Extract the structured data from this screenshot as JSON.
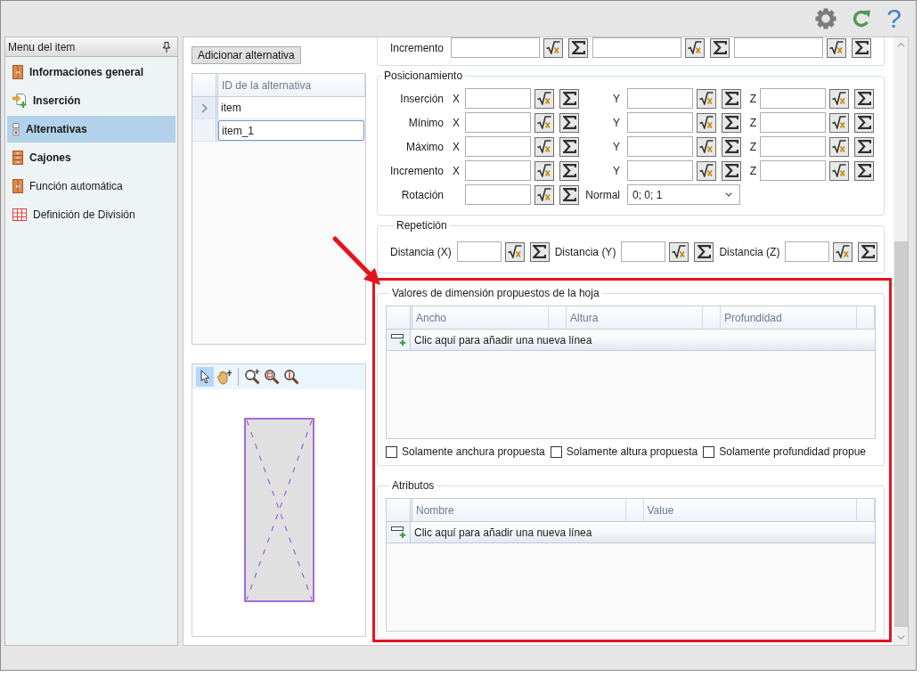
{
  "header": {
    "help_button": "?"
  },
  "sidebar": {
    "title": "Menu del item",
    "items": [
      {
        "label": "Informaciones general",
        "kind": "cabinet",
        "bold": true,
        "selected": false
      },
      {
        "label": "Inserción",
        "kind": "insert",
        "bold": true,
        "selected": false
      },
      {
        "label": "Alternativas",
        "kind": "alternatives",
        "bold": true,
        "selected": true
      },
      {
        "label": "Cajones",
        "kind": "drawers",
        "bold": true,
        "selected": false
      },
      {
        "label": "Función automática",
        "kind": "cabinet",
        "bold": false,
        "selected": false
      },
      {
        "label": "Definición de División",
        "kind": "grid",
        "bold": false,
        "selected": false
      }
    ]
  },
  "alternatives": {
    "add_button": "Adicionar alternativa",
    "column": "ID de la alternativa",
    "rows": [
      {
        "id": "item",
        "selected": true,
        "editing": false
      },
      {
        "id": "item_1",
        "selected": false,
        "editing": true
      }
    ]
  },
  "preview": {
    "tool_groups": [
      [
        {
          "kind": "pointer",
          "selected": true
        },
        {
          "kind": "pan",
          "selected": false
        }
      ],
      [
        {
          "kind": "zoom-in",
          "selected": false
        },
        {
          "kind": "zoom-window",
          "selected": false
        },
        {
          "kind": "zoom-extents",
          "selected": false
        }
      ]
    ]
  },
  "form": {
    "sections": [
      {
        "kind": "fields",
        "rows": [
          {
            "label": "Incremento",
            "fields": [
              {
                "kind": "number"
              },
              {
                "kind": "number"
              },
              {
                "kind": "number"
              }
            ]
          }
        ]
      },
      {
        "kind": "fields",
        "title": "Posicionamiento",
        "rows": [
          {
            "label": "Inserción",
            "fields": [
              {
                "kind": "number",
                "axis": "X"
              },
              {
                "kind": "number",
                "axis": "Y"
              },
              {
                "kind": "number",
                "axis": "Z"
              }
            ]
          },
          {
            "label": "Mínimo",
            "fields": [
              {
                "kind": "number",
                "axis": "X"
              },
              {
                "kind": "number",
                "axis": "Y"
              },
              {
                "kind": "number",
                "axis": "Z"
              }
            ]
          },
          {
            "label": "Máximo",
            "fields": [
              {
                "kind": "number",
                "axis": "X"
              },
              {
                "kind": "number",
                "axis": "Y"
              },
              {
                "kind": "number",
                "axis": "Z"
              }
            ]
          },
          {
            "label": "Incremento",
            "fields": [
              {
                "kind": "number",
                "axis": "X"
              },
              {
                "kind": "number",
                "axis": "Y"
              },
              {
                "kind": "number",
                "axis": "Z"
              }
            ]
          },
          {
            "label": "Rotación",
            "fields": [
              {
                "kind": "number"
              },
              {
                "kind": "dropdown",
                "label": "Normal",
                "value": "0; 0; 1"
              }
            ]
          }
        ]
      },
      {
        "kind": "fields",
        "title": "Repetición",
        "rows": [
          {
            "fields": [
              {
                "kind": "number",
                "label": "Distancia (X)"
              },
              {
                "kind": "number",
                "label": "Distancia (Y)"
              },
              {
                "kind": "number",
                "label": "Distancia (Z)"
              }
            ]
          }
        ]
      },
      {
        "kind": "table",
        "title": "Valores de dimensión propuestos de la hoja",
        "columns": [
          "Ancho",
          "Altura",
          "Profundidad"
        ],
        "new_row_prompt": "Clic aquí para añadir una nueva línea",
        "options": [
          {
            "label": "Solamente anchura propuesta",
            "checked": false
          },
          {
            "label": "Solamente altura propuesta",
            "checked": false
          },
          {
            "label": "Solamente profundidad propue",
            "checked": false
          }
        ]
      },
      {
        "kind": "table",
        "title": "Atributos",
        "columns": [
          "Nombre",
          "Value"
        ],
        "new_row_prompt": "Clic aquí para añadir una nueva línea"
      }
    ]
  }
}
